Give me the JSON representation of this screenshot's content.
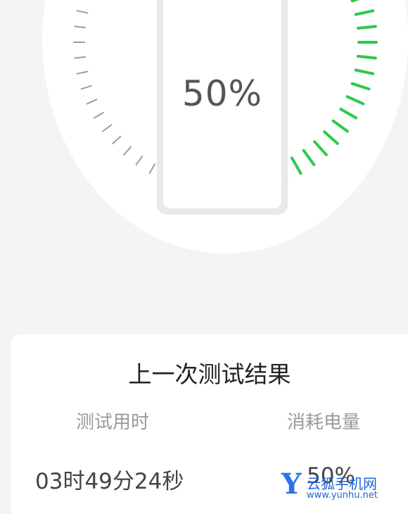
{
  "battery_test": {
    "level_percent": 50,
    "level_text": "50%",
    "accent_color": "#2fc94a",
    "inactive_tick_color": "#9e9e9e"
  },
  "results_card": {
    "title": "上一次测试结果",
    "duration_label": "测试用时",
    "duration_value": "03时49分24秒",
    "consumption_label": "消耗电量",
    "consumption_value": "50%"
  },
  "watermark": {
    "logo_letter": "Y",
    "site_name": "云狐手机网",
    "url": "www.yunhu.net"
  }
}
